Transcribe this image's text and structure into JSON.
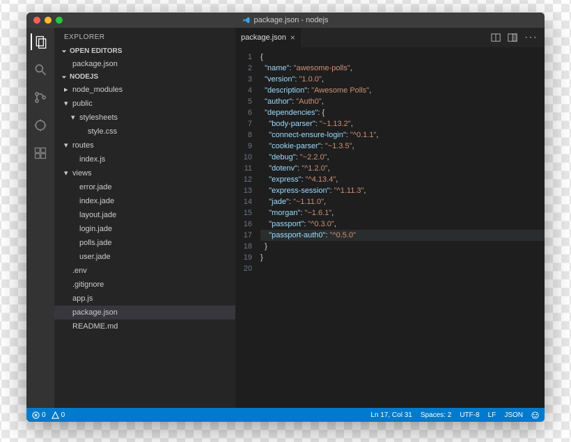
{
  "window": {
    "title": "package.json - nodejs"
  },
  "sidebar": {
    "title": "EXPLORER",
    "sections": {
      "open_editors": {
        "label": "OPEN EDITORS",
        "items": [
          "package.json"
        ]
      },
      "project": {
        "label": "NODEJS",
        "tree": [
          {
            "label": "node_modules",
            "depth": 0,
            "folder": true,
            "open": false
          },
          {
            "label": "public",
            "depth": 0,
            "folder": true,
            "open": true
          },
          {
            "label": "stylesheets",
            "depth": 1,
            "folder": true,
            "open": true
          },
          {
            "label": "style.css",
            "depth": 2,
            "folder": false
          },
          {
            "label": "routes",
            "depth": 0,
            "folder": true,
            "open": true
          },
          {
            "label": "index.js",
            "depth": 1,
            "folder": false
          },
          {
            "label": "views",
            "depth": 0,
            "folder": true,
            "open": true
          },
          {
            "label": "error.jade",
            "depth": 1,
            "folder": false
          },
          {
            "label": "index.jade",
            "depth": 1,
            "folder": false
          },
          {
            "label": "layout.jade",
            "depth": 1,
            "folder": false
          },
          {
            "label": "login.jade",
            "depth": 1,
            "folder": false
          },
          {
            "label": "polls.jade",
            "depth": 1,
            "folder": false
          },
          {
            "label": "user.jade",
            "depth": 1,
            "folder": false
          },
          {
            "label": ".env",
            "depth": 0,
            "folder": false
          },
          {
            "label": ".gitignore",
            "depth": 0,
            "folder": false
          },
          {
            "label": "app.js",
            "depth": 0,
            "folder": false
          },
          {
            "label": "package.json",
            "depth": 0,
            "folder": false,
            "selected": true
          },
          {
            "label": "README.md",
            "depth": 0,
            "folder": false
          }
        ]
      }
    }
  },
  "editor": {
    "tabs": [
      {
        "label": "package.json",
        "active": true
      }
    ],
    "file_content": {
      "name": "awesome-polls",
      "version": "1.0.0",
      "description": "Awesome Polls",
      "author": "Auth0",
      "dependencies": {
        "body-parser": "~1.13.2",
        "connect-ensure-login": "^0.1.1",
        "cookie-parser": "~1.3.5",
        "debug": "~2.2.0",
        "dotenv": "^1.2.0",
        "express": "^4.13.4",
        "express-session": "^1.11.3",
        "jade": "~1.11.0",
        "morgan": "~1.6.1",
        "passport": "^0.3.0",
        "passport-auth0": "^0.5.0"
      }
    },
    "cursor_line": 17,
    "total_lines": 20
  },
  "statusbar": {
    "errors": "0",
    "warnings": "0",
    "cursor": "Ln 17, Col 31",
    "spaces": "Spaces: 2",
    "encoding": "UTF-8",
    "eol": "LF",
    "language": "JSON"
  }
}
